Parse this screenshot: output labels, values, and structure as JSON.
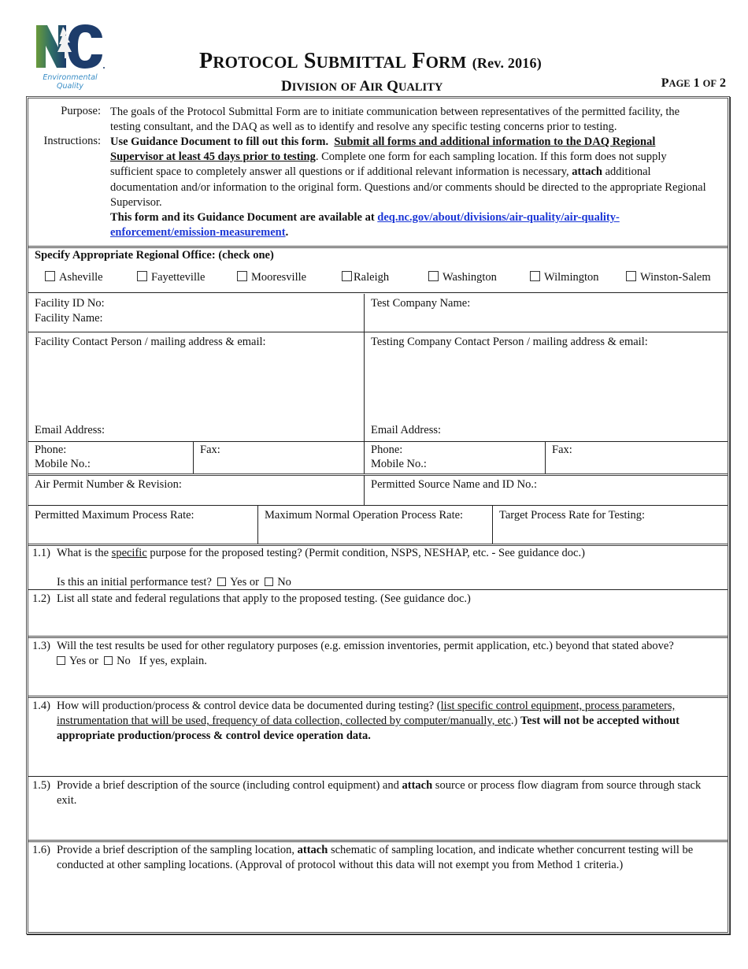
{
  "header": {
    "logo": {
      "icon": "nc-deq-logo-icon",
      "letters": "NC",
      "caption_line1": "Environmental",
      "caption_line2": "Quality",
      "colors": {
        "green": "#6a9a3a",
        "navy": "#1d3c6b",
        "caption": "#3b8ec6"
      }
    },
    "title": {
      "p1_cap": "P",
      "p1_rest": "ROTOCOL",
      "p2_cap": "S",
      "p2_rest": "UBMITTAL",
      "p3_cap": "F",
      "p3_rest": "ORM",
      "rev": "(Rev. 2016)"
    },
    "subtitle": {
      "w1_cap": "D",
      "w1_rest": "IVISION",
      "w2": "OF",
      "w3_cap": "A",
      "w3_rest": "IR",
      "w4_cap": "Q",
      "w4_rest": "UALITY"
    },
    "page": {
      "p_cap": "P",
      "p_rest": "AGE",
      "num": "1",
      "of": "OF",
      "total": "2"
    }
  },
  "intro": {
    "purpose_label": "Purpose:",
    "purpose_text": "The goals of the Protocol Submittal Form are to initiate communication between representatives of the permitted facility, the testing consultant, and the DAQ as well as to identify and resolve any specific testing concerns prior to testing.",
    "instructions_label": "Instructions:",
    "instr_bold": "Use Guidance Document to fill out this form.",
    "instr_bold_underline": "Submit all forms and additional information to the DAQ Regional Supervisor at least 45 days prior to testing",
    "instr_text1": ".  Complete one form for each sampling location.  If this form does not supply sufficient space to completely answer all questions or if additional relevant information is necessary, ",
    "instr_attach": "attach",
    "instr_text2": " additional documentation and/or information to the original form.  Questions and/or comments should be directed to the appropriate Regional Supervisor.",
    "available_text": "This form and its Guidance Document are available at ",
    "link_text": "deq.nc.gov/about/divisions/air-quality/air-quality-enforcement/emission-measurement",
    "link_color": "#1c37d6",
    "period": "."
  },
  "regional": {
    "title": "Specify Appropriate Regional Office: (check one)",
    "options": [
      {
        "label": "Asheville",
        "checked": false
      },
      {
        "label": "Fayetteville",
        "checked": false
      },
      {
        "label": "Mooresville",
        "checked": false
      },
      {
        "label": "Raleigh",
        "checked": false
      },
      {
        "label": "Washington",
        "checked": false
      },
      {
        "label": "Wilmington",
        "checked": false
      },
      {
        "label": "Winston-Salem",
        "checked": false
      }
    ]
  },
  "fields": {
    "facility_id": "Facility ID No:",
    "facility_name": "Facility Name:",
    "test_company_name": "Test Company Name:",
    "facility_contact": "Facility Contact Person / mailing address & email:",
    "testing_contact": "Testing Company Contact Person / mailing address & email:",
    "email_address": "Email Address:",
    "phone": "Phone:",
    "mobile": "Mobile No.:",
    "fax": "Fax:",
    "air_permit": "Air Permit Number & Revision:",
    "permitted_source": "Permitted Source Name and ID No.:",
    "permitted_max_rate": "Permitted Maximum Process Rate:",
    "max_normal_rate": "Maximum Normal Operation Process Rate:",
    "target_rate": "Target Process Rate for Testing:"
  },
  "questions": {
    "q11": {
      "num": "1.1)",
      "text_a": "What is the ",
      "text_u": "specific",
      "text_b": " purpose for the proposed testing?  (Permit condition, NSPS, NESHAP, etc. - See guidance doc.)",
      "sub": "Is this an initial performance test?",
      "yes": "Yes or",
      "no": "No"
    },
    "q12": {
      "num": "1.2)",
      "text": "List all state and federal regulations that apply to the proposed testing. (See guidance doc.)"
    },
    "q13": {
      "num": "1.3)",
      "text": "Will the test results be used for other regulatory purposes (e.g. emission inventories, permit application, etc.) beyond that stated above?",
      "yes": "Yes or",
      "no": "No",
      "explain": "If yes, explain."
    },
    "q14": {
      "num": "1.4)",
      "text_a": "How will production/process & control device data be documented during testing? (",
      "text_u": "list specific control equipment, process parameters, instrumentation that will be used, frequency of data collection, collected by computer/manually, etc",
      "text_b": ".)  ",
      "text_bold": "Test will not be accepted without appropriate production/process & control device operation data."
    },
    "q15": {
      "num": "1.5)",
      "text_a": "Provide a brief description of the source (including control equipment) and ",
      "text_bold": "attach",
      "text_b": " source or process flow diagram from source through stack exit."
    },
    "q16": {
      "num": "1.6)",
      "text_a": "Provide a brief description of the sampling location, ",
      "text_bold": "attach",
      "text_b": " schematic of sampling location, and indicate whether concurrent testing will be conducted at other sampling locations. (Approval of protocol without this data will not exempt you from Method 1 criteria.)"
    }
  }
}
